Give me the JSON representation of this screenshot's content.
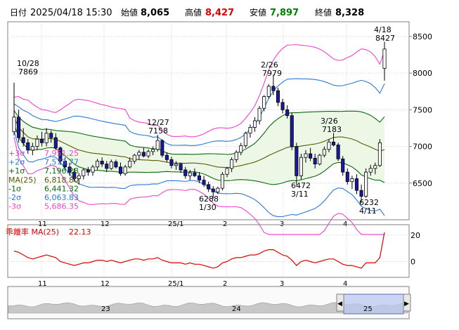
{
  "header": {
    "date_label": "日付",
    "datetime": "2025/04/18 15:30",
    "open_label": "始値",
    "open_value": "8,065",
    "high_label": "高値",
    "high_value": "8,427",
    "low_label": "安値",
    "low_value": "7,897",
    "close_label": "終値",
    "close_value": "8,328"
  },
  "colors": {
    "up": "#ffffff",
    "down": "#1a1aa0",
    "ma": "#5a5a00",
    "band1": "#0a6a0a",
    "band2": "#2a7ad8",
    "band3": "#ee44cc",
    "band_fill": "#ecf7e6",
    "deviation": "#dd0000",
    "high": "#dd0000",
    "low": "#008000",
    "ma_legend": "#996600",
    "grid": "#d0d0d0",
    "nav_fill": "#b8c8f0"
  },
  "legend": [
    {
      "label": "+3σ",
      "value": "7,951.25",
      "color": "#ee44cc"
    },
    {
      "label": "+2σ",
      "value": "7,573.77",
      "color": "#2a7ad8"
    },
    {
      "label": "+1σ",
      "value": "7,196.28",
      "color": "#0a6a0a"
    },
    {
      "label": "MA(25)",
      "value": "6,818.80",
      "color": "#5a5a00"
    },
    {
      "label": "-1σ",
      "value": "6,441.32",
      "color": "#0a6a0a"
    },
    {
      "label": "-2σ",
      "value": "6,063.83",
      "color": "#2a7ad8"
    },
    {
      "label": "-3σ",
      "value": "5,686.35",
      "color": "#ee44cc"
    }
  ],
  "x_ticks": [
    "11",
    "12",
    "25/1",
    "2",
    "3",
    "4"
  ],
  "navigator": {
    "ticks": [
      "23",
      "24",
      "25"
    ],
    "scroll_left": "◀",
    "scroll_right": "▶"
  },
  "chart_data": [
    {
      "type": "candlestick",
      "ylim": [
        6000,
        8700
      ],
      "y_ticks": [
        6500,
        7000,
        7500,
        8000,
        8500
      ],
      "indicators": [
        "MA(25)",
        "Bollinger ±1σ/±2σ/±3σ"
      ],
      "annotations": [
        {
          "date": "10/28",
          "value": "7869"
        },
        {
          "date": "12/27",
          "value": "7158"
        },
        {
          "date": "2/26",
          "value": "7979"
        },
        {
          "date": "3/26",
          "value": "7183"
        },
        {
          "date": "4/18",
          "value": "8427"
        },
        {
          "date": "3/11",
          "value": "6472"
        },
        {
          "date": "1/30",
          "value": "6288"
        },
        {
          "date": "4/11",
          "value": "6232"
        }
      ],
      "candles": [
        [
          7200,
          7869,
          7150,
          7400
        ],
        [
          7400,
          7500,
          7050,
          7120
        ],
        [
          7120,
          7250,
          7000,
          7050
        ],
        [
          7050,
          7100,
          6900,
          6950
        ],
        [
          6950,
          7050,
          6880,
          7000
        ],
        [
          7000,
          7150,
          6950,
          7100
        ],
        [
          7100,
          7200,
          7000,
          7050
        ],
        [
          7050,
          7250,
          7000,
          7180
        ],
        [
          7180,
          7220,
          7050,
          7120
        ],
        [
          7120,
          7180,
          6950,
          6980
        ],
        [
          6980,
          7000,
          6750,
          6800
        ],
        [
          6800,
          6850,
          6680,
          6720
        ],
        [
          6720,
          6780,
          6600,
          6650
        ],
        [
          6650,
          6700,
          6520,
          6560
        ],
        [
          6560,
          6640,
          6480,
          6600
        ],
        [
          6600,
          6700,
          6550,
          6680
        ],
        [
          6680,
          6720,
          6600,
          6650
        ],
        [
          6650,
          6750,
          6600,
          6720
        ],
        [
          6720,
          6830,
          6680,
          6800
        ],
        [
          6800,
          6850,
          6720,
          6760
        ],
        [
          6760,
          6800,
          6650,
          6700
        ],
        [
          6700,
          6820,
          6680,
          6790
        ],
        [
          6790,
          6820,
          6700,
          6720
        ],
        [
          6720,
          6780,
          6600,
          6630
        ],
        [
          6630,
          6750,
          6600,
          6720
        ],
        [
          6720,
          6850,
          6700,
          6800
        ],
        [
          6800,
          6900,
          6760,
          6880
        ],
        [
          6880,
          6950,
          6820,
          6920
        ],
        [
          6920,
          6980,
          6850,
          6870
        ],
        [
          6870,
          6960,
          6840,
          6930
        ],
        [
          6930,
          7000,
          6880,
          6960
        ],
        [
          6960,
          7158,
          6930,
          7080
        ],
        [
          7080,
          7100,
          6850,
          6880
        ],
        [
          6880,
          6920,
          6780,
          6820
        ],
        [
          6820,
          6860,
          6700,
          6740
        ],
        [
          6740,
          6800,
          6680,
          6760
        ],
        [
          6760,
          6780,
          6640,
          6680
        ],
        [
          6680,
          6720,
          6560,
          6600
        ],
        [
          6600,
          6680,
          6540,
          6640
        ],
        [
          6640,
          6700,
          6580,
          6600
        ],
        [
          6600,
          6650,
          6500,
          6540
        ],
        [
          6540,
          6600,
          6450,
          6480
        ],
        [
          6480,
          6520,
          6380,
          6420
        ],
        [
          6420,
          6460,
          6288,
          6380
        ],
        [
          6380,
          6450,
          6350,
          6430
        ],
        [
          6430,
          6650,
          6400,
          6620
        ],
        [
          6620,
          6720,
          6580,
          6700
        ],
        [
          6700,
          6850,
          6650,
          6820
        ],
        [
          6820,
          6950,
          6780,
          6920
        ],
        [
          6920,
          7050,
          6880,
          7010
        ],
        [
          7010,
          7200,
          6980,
          7180
        ],
        [
          7180,
          7300,
          7120,
          7260
        ],
        [
          7260,
          7400,
          7200,
          7350
        ],
        [
          7350,
          7550,
          7300,
          7520
        ],
        [
          7520,
          7700,
          7480,
          7680
        ],
        [
          7680,
          7850,
          7650,
          7820
        ],
        [
          7820,
          7979,
          7700,
          7760
        ],
        [
          7760,
          7800,
          7550,
          7600
        ],
        [
          7600,
          7650,
          7450,
          7500
        ],
        [
          7500,
          7560,
          7380,
          7420
        ],
        [
          7420,
          7460,
          6950,
          7000
        ],
        [
          7000,
          7050,
          6472,
          6600
        ],
        [
          6600,
          6900,
          6550,
          6850
        ],
        [
          6850,
          6950,
          6780,
          6900
        ],
        [
          6900,
          6980,
          6800,
          6840
        ],
        [
          6840,
          6900,
          6700,
          6760
        ],
        [
          6760,
          6900,
          6740,
          6880
        ],
        [
          6880,
          7000,
          6850,
          6960
        ],
        [
          6960,
          7100,
          6920,
          7060
        ],
        [
          7060,
          7183,
          7000,
          7020
        ],
        [
          7020,
          7050,
          6800,
          6830
        ],
        [
          6830,
          6870,
          6600,
          6650
        ],
        [
          6650,
          6700,
          6480,
          6520
        ],
        [
          6520,
          6600,
          6420,
          6560
        ],
        [
          6560,
          6620,
          6350,
          6400
        ],
        [
          6400,
          6480,
          6232,
          6320
        ],
        [
          6320,
          6700,
          6300,
          6650
        ],
        [
          6650,
          6750,
          6600,
          6700
        ],
        [
          6700,
          6780,
          6620,
          6740
        ],
        [
          6740,
          7100,
          6720,
          7050
        ],
        [
          8065,
          8427,
          7897,
          8328
        ]
      ]
    },
    {
      "type": "line",
      "title": "乖離率 MA(25)",
      "value_label": "22.13",
      "ylim": [
        -12,
        28
      ],
      "y_ticks": [
        0,
        20
      ],
      "series": [
        {
          "values": [
            8,
            7,
            5,
            3,
            2,
            3,
            4,
            5,
            4,
            3,
            0,
            -1,
            -2,
            -3,
            -2,
            -1,
            -1,
            0,
            1,
            1,
            0,
            1,
            0,
            -1,
            0,
            1,
            2,
            2,
            1,
            2,
            2,
            3,
            1,
            0,
            -1,
            -1,
            -1,
            -2,
            -1,
            -2,
            -2,
            -3,
            -4,
            -5,
            -4,
            -1,
            0,
            2,
            3,
            3,
            4,
            5,
            5,
            6,
            8,
            9,
            9,
            7,
            5,
            4,
            1,
            -3,
            0,
            1,
            0,
            -1,
            0,
            1,
            2,
            2,
            0,
            -2,
            -3,
            -3,
            -4,
            -5,
            -1,
            -1,
            -1,
            3,
            22.13
          ]
        }
      ]
    }
  ]
}
